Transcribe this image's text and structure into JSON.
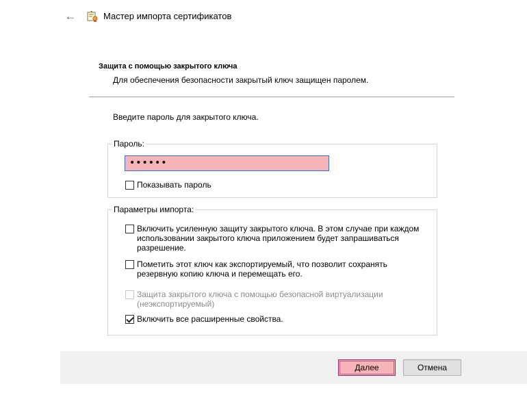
{
  "window": {
    "title": "Мастер импорта сертификатов"
  },
  "header": {
    "section_title": "Защита с помощью закрытого ключа",
    "section_subtitle": "Для обеспечения безопасности закрытый ключ защищен паролем."
  },
  "content": {
    "prompt": "Введите пароль для закрытого ключа.",
    "password_group": {
      "legend": "Пароль:",
      "value": "••••••",
      "show_password": {
        "label": "Показывать пароль",
        "checked": false
      }
    },
    "import_group": {
      "legend": "Параметры импорта:",
      "options": [
        {
          "line1": "Включить усиленную защиту закрытого ключа. В этом случае при каждом",
          "line2": "использовании закрытого ключа приложением будет запрашиваться",
          "line3": "разрешение.",
          "checked": false,
          "enabled": true
        },
        {
          "line1": "Пометить этот ключ как экспортируемый, что позволит сохранять",
          "line2": "резервную копию ключа и перемещать его.",
          "checked": false,
          "enabled": true
        },
        {
          "line1": "Защита закрытого ключа с помощью безопасной виртуализации",
          "line2": "(неэкспортируемый)",
          "checked": false,
          "enabled": false
        },
        {
          "line1": "Включить все расширенные свойства.",
          "checked": true,
          "enabled": true
        }
      ]
    }
  },
  "footer": {
    "next_label": "Далее",
    "cancel_label": "Отмена"
  },
  "colors": {
    "highlight": "#f7b4b8",
    "focus_border": "#3b6ccf"
  }
}
